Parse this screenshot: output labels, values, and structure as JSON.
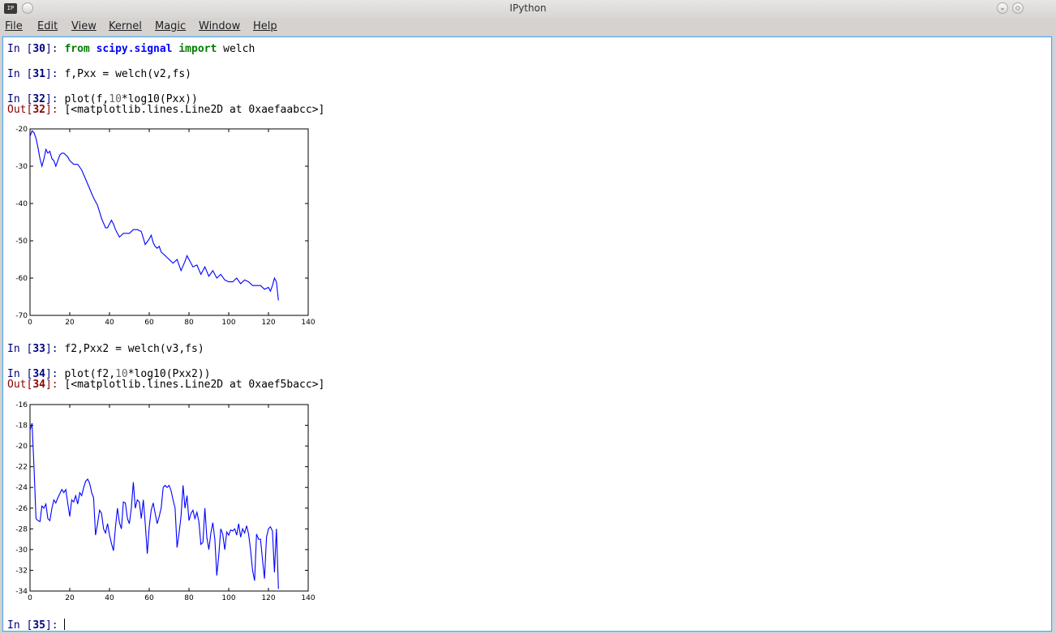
{
  "window": {
    "title": "IPython",
    "app_icon_label": "IP"
  },
  "menu": [
    "File",
    "Edit",
    "View",
    "Kernel",
    "Magic",
    "Window",
    "Help"
  ],
  "cells": {
    "c30": {
      "prompt_pre": "In [",
      "num": "30",
      "prompt_post": "]: ",
      "kw1": "from",
      "mod": "scipy.signal",
      "kw2": "import",
      "rest": "welch"
    },
    "c31": {
      "prompt_pre": "In [",
      "num": "31",
      "prompt_post": "]: ",
      "code": "f,Pxx = welch(v2,fs)"
    },
    "c32": {
      "prompt_pre": "In [",
      "num": "32",
      "prompt_post": "]: ",
      "code_a": "plot(f,",
      "code_num": "10",
      "code_b": "*log10(Pxx))"
    },
    "o32": {
      "prompt_pre": "Out[",
      "num": "32",
      "prompt_post": "]: ",
      "text": "[<matplotlib.lines.Line2D at 0xaefaabcc>]"
    },
    "c33": {
      "prompt_pre": "In [",
      "num": "33",
      "prompt_post": "]: ",
      "code": "f2,Pxx2 = welch(v3,fs)"
    },
    "c34": {
      "prompt_pre": "In [",
      "num": "34",
      "prompt_post": "]: ",
      "code_a": "plot(f2,",
      "code_num": "10",
      "code_b": "*log10(Pxx2))"
    },
    "o34": {
      "prompt_pre": "Out[",
      "num": "34",
      "prompt_post": "]: ",
      "text": "[<matplotlib.lines.Line2D at 0xaef5bacc>]"
    },
    "c35": {
      "prompt_pre": "In [",
      "num": "35",
      "prompt_post": "]: "
    }
  },
  "chart_data": [
    {
      "type": "line",
      "xlim": [
        0,
        140
      ],
      "ylim": [
        -70,
        -20
      ],
      "xticks": [
        0,
        20,
        40,
        60,
        80,
        100,
        120,
        140
      ],
      "yticks": [
        -20,
        -30,
        -40,
        -50,
        -60,
        -70
      ],
      "line_color": "#0000ff",
      "grid": false,
      "x": [
        0,
        1,
        2,
        3,
        4,
        5,
        6,
        7,
        8,
        9,
        10,
        11,
        12,
        13,
        14,
        15,
        16,
        17,
        18,
        19,
        20,
        22,
        24,
        26,
        28,
        30,
        32,
        34,
        36,
        38,
        39,
        40,
        41,
        42,
        43,
        44,
        45,
        46,
        47,
        48,
        50,
        52,
        54,
        56,
        58,
        60,
        61,
        62,
        63,
        64,
        65,
        66,
        68,
        70,
        72,
        74,
        76,
        78,
        79,
        80,
        82,
        84,
        86,
        88,
        90,
        92,
        94,
        96,
        98,
        100,
        102,
        104,
        106,
        108,
        110,
        112,
        114,
        116,
        118,
        120,
        121,
        122,
        123,
        124,
        125
      ],
      "y": [
        -22,
        -20.5,
        -21,
        -22.5,
        -25,
        -28,
        -30,
        -28,
        -25.5,
        -26.5,
        -26,
        -28,
        -28.5,
        -30,
        -28.5,
        -27,
        -26.5,
        -26.5,
        -27,
        -27.5,
        -28.5,
        -29.5,
        -29.5,
        -31,
        -33.5,
        -36,
        -38.5,
        -40.5,
        -44,
        -46.5,
        -46.5,
        -45.5,
        -44.5,
        -45.5,
        -47,
        -48,
        -49,
        -48.5,
        -48,
        -48,
        -48,
        -47,
        -47,
        -47.5,
        -51,
        -49.5,
        -48.5,
        -50.5,
        -51.5,
        -52,
        -51.5,
        -53,
        -54,
        -55,
        -56,
        -55,
        -58,
        -55.5,
        -54,
        -55,
        -57,
        -56.5,
        -59,
        -57,
        -59.5,
        -58,
        -60,
        -59,
        -60.5,
        -61,
        -61,
        -60,
        -61.5,
        -60.5,
        -61,
        -62,
        -62,
        -62,
        -63,
        -62.5,
        -63.5,
        -62,
        -60,
        -61,
        -66
      ]
    },
    {
      "type": "line",
      "xlim": [
        0,
        140
      ],
      "ylim": [
        -34,
        -16
      ],
      "xticks": [
        0,
        20,
        40,
        60,
        80,
        100,
        120,
        140
      ],
      "yticks": [
        -16,
        -18,
        -20,
        -22,
        -24,
        -26,
        -28,
        -30,
        -32,
        -34
      ],
      "line_color": "#0000ff",
      "grid": false,
      "x": [
        0,
        1,
        2,
        3,
        4,
        5,
        6,
        7,
        8,
        9,
        10,
        11,
        12,
        13,
        14,
        15,
        16,
        17,
        18,
        19,
        20,
        21,
        22,
        23,
        24,
        25,
        26,
        27,
        28,
        29,
        30,
        31,
        32,
        33,
        34,
        35,
        36,
        37,
        38,
        39,
        40,
        41,
        42,
        43,
        44,
        45,
        46,
        47,
        48,
        49,
        50,
        51,
        52,
        53,
        54,
        55,
        56,
        57,
        58,
        59,
        60,
        61,
        62,
        63,
        64,
        65,
        66,
        67,
        68,
        69,
        70,
        71,
        72,
        73,
        74,
        75,
        76,
        77,
        78,
        79,
        80,
        81,
        82,
        83,
        84,
        85,
        86,
        87,
        88,
        89,
        90,
        91,
        92,
        93,
        94,
        95,
        96,
        97,
        98,
        99,
        100,
        101,
        102,
        103,
        104,
        105,
        106,
        107,
        108,
        109,
        110,
        111,
        112,
        113,
        114,
        115,
        116,
        117,
        118,
        119,
        120,
        121,
        122,
        123,
        124,
        125
      ],
      "y": [
        -18.5,
        -17.8,
        -22,
        -27,
        -27.2,
        -27.3,
        -25.8,
        -26,
        -25.6,
        -27,
        -27.2,
        -26,
        -25.2,
        -25.5,
        -25,
        -24.6,
        -24.2,
        -24.5,
        -24.2,
        -25.5,
        -26.8,
        -25.2,
        -25.4,
        -24.8,
        -25.6,
        -24.5,
        -24.8,
        -24,
        -23.4,
        -23.2,
        -23.6,
        -24.5,
        -25,
        -28.6,
        -27.5,
        -26.2,
        -26.5,
        -28,
        -28.4,
        -27.5,
        -28.6,
        -29.4,
        -30.1,
        -27.8,
        -26,
        -27.4,
        -28,
        -25.4,
        -25.5,
        -27,
        -27.5,
        -26,
        -23.5,
        -26,
        -25.2,
        -25.4,
        -27,
        -25.2,
        -27.5,
        -30.4,
        -27.8,
        -26.2,
        -25.5,
        -26.5,
        -27.5,
        -26.8,
        -26,
        -24,
        -23.8,
        -24,
        -23.8,
        -24.3,
        -25.2,
        -26,
        -29.8,
        -28.4,
        -26.8,
        -23.8,
        -26,
        -24.8,
        -27.2,
        -26.5,
        -26.2,
        -27,
        -26.4,
        -27.3,
        -29.5,
        -29.3,
        -26,
        -28.8,
        -30,
        -28.4,
        -27.4,
        -29,
        -32.5,
        -30.5,
        -28,
        -28.5,
        -30,
        -28.3,
        -28.6,
        -28.1,
        -28.2,
        -28,
        -28.6,
        -27.5,
        -28.8,
        -28,
        -28.4,
        -27.7,
        -28.5,
        -30,
        -32,
        -33,
        -28.5,
        -29,
        -29,
        -31,
        -32.8,
        -28.8,
        -28,
        -27.8,
        -28.2,
        -32.2,
        -28,
        -33.8
      ]
    }
  ]
}
